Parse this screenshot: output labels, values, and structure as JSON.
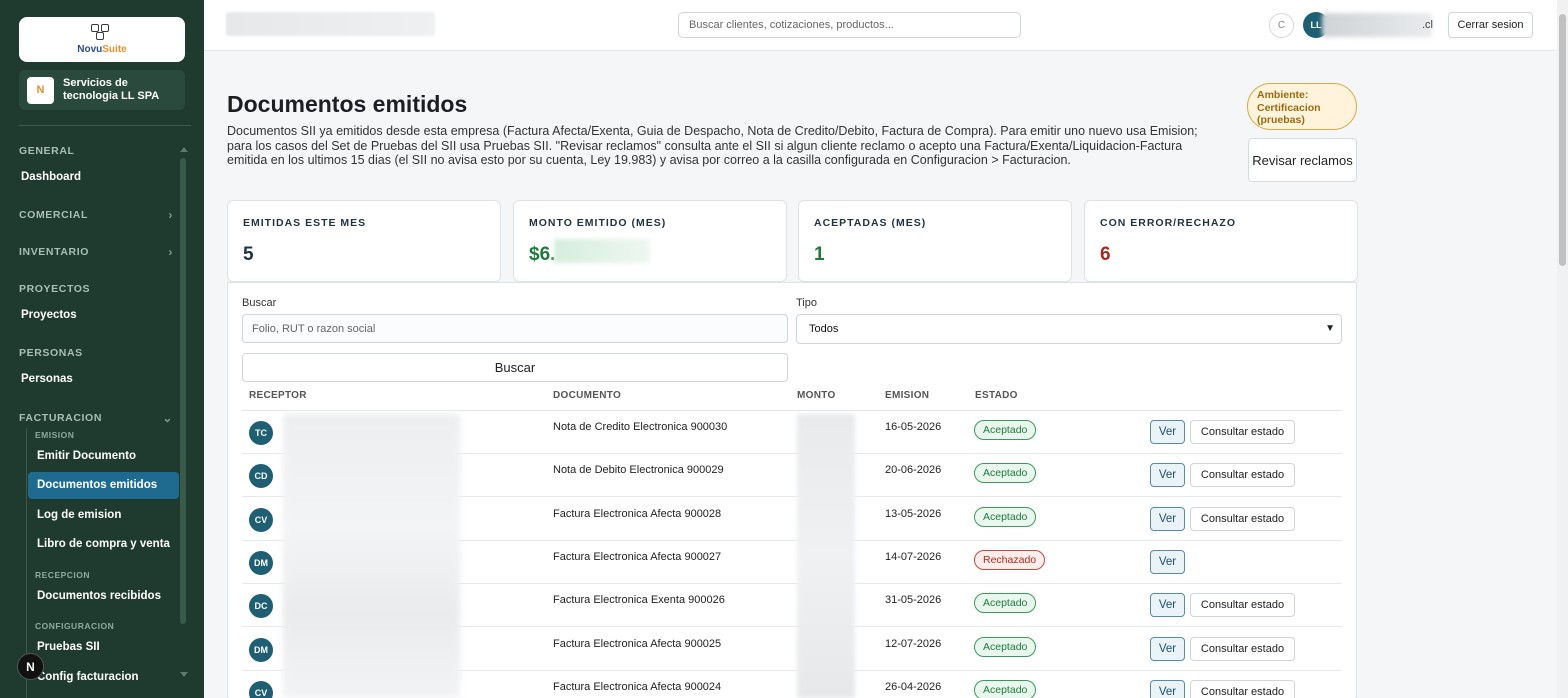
{
  "sidebar": {
    "logo": {
      "part1": "Novu",
      "part2": "Suite"
    },
    "company": {
      "logo_text": "N",
      "name": "Servicios de tecnologia LL SPA"
    },
    "sections": {
      "general": "GENERAL",
      "comercial": "COMERCIAL",
      "inventario": "INVENTARIO",
      "proyectos": "PROYECTOS",
      "personas": "PERSONAS",
      "facturacion": "FACTURACION"
    },
    "items": {
      "dashboard": "Dashboard",
      "proyectos": "Proyectos",
      "personas": "Personas"
    },
    "facturacion": {
      "emision_label": "EMISION",
      "emitir": "Emitir Documento",
      "emitidos": "Documentos emitidos",
      "log": "Log de emision",
      "libro": "Libro de compra y venta",
      "recepcion_label": "RECEPCION",
      "recibidos": "Documentos recibidos",
      "config_label": "CONFIGURACION",
      "pruebas": "Pruebas SII",
      "config": "Config facturacion"
    },
    "n_badge": "N"
  },
  "topbar": {
    "search_placeholder": "Buscar clientes, cotizaciones, productos...",
    "theme_icon": "C",
    "user_initials": "LL",
    "user_email_suffix": ".cl",
    "logout": "Cerrar sesion"
  },
  "page": {
    "title": "Documentos emitidos",
    "description": "Documentos SII ya emitidos desde esta empresa (Factura Afecta/Exenta, Guia de Despacho, Nota de Credito/Debito, Factura de Compra). Para emitir uno nuevo usa Emision; para los casos del Set de Pruebas del SII usa Pruebas SII. \"Revisar reclamos\" consulta ante el SII si algun cliente reclamo o acepto una Factura/Exenta/Liquidacion-Factura emitida en los ultimos 15 dias (el SII no avisa esto por su cuenta, Ley 19.983) y avisa por correo a la casilla configurada en Configuracion > Facturacion.",
    "env_badge": "Ambiente: Certificacion (pruebas)",
    "review_button": "Revisar reclamos"
  },
  "stats": [
    {
      "label": "EMITIDAS ESTE MES",
      "value": "5",
      "color": "#1f3340"
    },
    {
      "label": "MONTO EMITIDO (MES)",
      "value": "$6.",
      "color": "#1f7a3c"
    },
    {
      "label": "ACEPTADAS (MES)",
      "value": "1",
      "color": "#1f7a3c"
    },
    {
      "label": "CON ERROR/RECHAZO",
      "value": "6",
      "color": "#a32a1c"
    }
  ],
  "filters": {
    "search_label": "Buscar",
    "search_placeholder": "Folio, RUT o razon social",
    "type_label": "Tipo",
    "type_value": "Todos",
    "search_button": "Buscar"
  },
  "table": {
    "headers": {
      "receptor": "RECEPTOR",
      "documento": "DOCUMENTO",
      "monto": "MONTO",
      "emision": "EMISION",
      "estado": "ESTADO"
    },
    "rows": [
      {
        "initials": "TC",
        "document": "Nota de Credito Electronica 900030",
        "date": "16-05-2026",
        "status": "Aceptado",
        "view": "Ver",
        "check": "Consultar estado"
      },
      {
        "initials": "CD",
        "document": "Nota de Debito Electronica 900029",
        "date": "20-06-2026",
        "status": "Aceptado",
        "view": "Ver",
        "check": "Consultar estado"
      },
      {
        "initials": "CV",
        "document": "Factura Electronica Afecta 900028",
        "date": "13-05-2026",
        "status": "Aceptado",
        "view": "Ver",
        "check": "Consultar estado"
      },
      {
        "initials": "DM",
        "document": "Factura Electronica Afecta 900027",
        "date": "14-07-2026",
        "status": "Rechazado",
        "view": "Ver",
        "check": ""
      },
      {
        "initials": "DC",
        "document": "Factura Electronica Exenta 900026",
        "date": "31-05-2026",
        "status": "Aceptado",
        "view": "Ver",
        "check": "Consultar estado"
      },
      {
        "initials": "DM",
        "document": "Factura Electronica Afecta 900025",
        "date": "12-07-2026",
        "status": "Aceptado",
        "view": "Ver",
        "check": "Consultar estado"
      },
      {
        "initials": "CV",
        "document": "Factura Electronica Afecta 900024",
        "date": "26-04-2026",
        "status": "Aceptado",
        "view": "Ver",
        "check": "Consultar estado"
      }
    ]
  }
}
